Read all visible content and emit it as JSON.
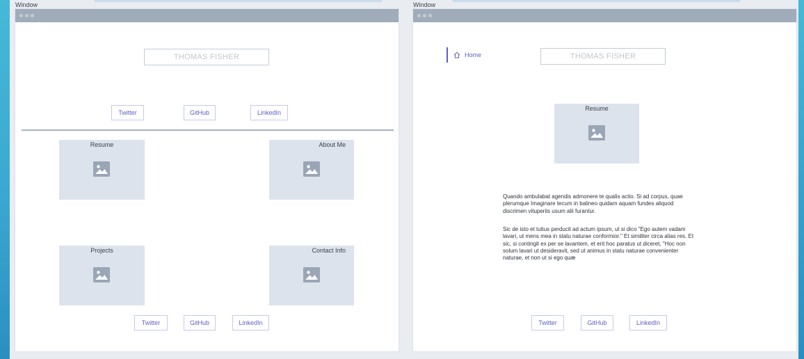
{
  "windows": [
    {
      "label": "Window",
      "name": "THOMAS FISHER",
      "top_links": [
        "Twitter",
        "GitHub",
        "LinkedIn"
      ],
      "cards": [
        "Resume",
        "About Me",
        "Projects",
        "Contact Info"
      ],
      "bottom_links": [
        "Twitter",
        "GitHub",
        "LinkedIn"
      ]
    },
    {
      "label": "Window",
      "nav_home": "Home",
      "name": "THOMAS FISHER",
      "card": "Resume",
      "paragraph1": "Quando ambulabat agendis admonere te qualis actio. Si ad corpus, quae plerumque Imaginare tecum in balineo quidam aquam fundes aliquod discrimen vituperiis usum alii furantur.",
      "paragraph2": "Sic de isto et tutius perducit ad actum ipsum, ut si dico \"Ego autem vadam lavari, ut mens mea in statu naturae conformior.\" Et similiter circa alias res. Et sic, si contingit ex per se lavantem, et erit hoc paratus ut diceret, \"Hoc non solum lavari ut desideravit, sed ut animus in statu naturae convenienter naturae, et non ut si ego quæ",
      "bottom_links": [
        "Twitter",
        "GitHub",
        "LinkedIn"
      ]
    }
  ],
  "colors": {
    "accent": "#5b5fc7",
    "titlebar": "#a1acbb",
    "placeholder": "#dde3ec",
    "frame": "#3aa8cf"
  },
  "icons": [
    "image-placeholder-icon",
    "home-icon"
  ]
}
